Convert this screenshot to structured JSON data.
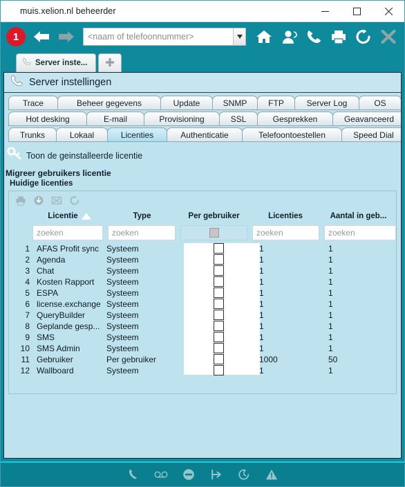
{
  "window": {
    "title": "muis.xelion.nl beheerder",
    "minimize_label": "Minimize",
    "maximize_label": "Maximize",
    "close_label": "Close"
  },
  "app_toolbar": {
    "badge": "1",
    "back_label": "Vorige",
    "forward_label": "Volgende",
    "search_placeholder": "<naam of telefoonnummer>",
    "search_value": "",
    "dropdown_label": "Open keuzelijst",
    "icons": [
      {
        "name": "home-icon",
        "label": "Home"
      },
      {
        "name": "contacts-icon",
        "label": "Contacten"
      },
      {
        "name": "phone-icon",
        "label": "Bellen"
      },
      {
        "name": "printer-icon",
        "label": "Afdrukken"
      },
      {
        "name": "refresh-icon",
        "label": "Vernieuwen"
      },
      {
        "name": "close-icon",
        "label": "Sluiten"
      }
    ]
  },
  "browser_tabs": {
    "tabs": [
      {
        "label": "Server inste...",
        "icon": "phone-icon",
        "active": true
      }
    ],
    "new_tab_label": "+"
  },
  "page": {
    "title": "Server instellingen",
    "icon": "phone-icon"
  },
  "nav_tabs": {
    "row1": [
      {
        "label": "Trace",
        "active": false
      },
      {
        "label": "Beheer gegevens",
        "active": false
      },
      {
        "label": "Update",
        "active": false
      },
      {
        "label": "SNMP",
        "active": false
      },
      {
        "label": "FTP",
        "active": false
      },
      {
        "label": "Server Log",
        "active": false
      },
      {
        "label": "OS",
        "active": false
      }
    ],
    "row2": [
      {
        "label": "Hot desking",
        "active": false
      },
      {
        "label": "E-mail",
        "active": false
      },
      {
        "label": "Provisioning",
        "active": false
      },
      {
        "label": "SSL",
        "active": false
      },
      {
        "label": "Gesprekken",
        "active": false
      },
      {
        "label": "Geavanceerd",
        "active": false
      }
    ],
    "row3": [
      {
        "label": "Trunks",
        "active": false
      },
      {
        "label": "Lokaal",
        "active": false
      },
      {
        "label": "Licenties",
        "active": true
      },
      {
        "label": "Authenticatie",
        "active": false
      },
      {
        "label": "Telefoontoestellen",
        "active": false
      },
      {
        "label": "Speed Dial",
        "active": false
      }
    ]
  },
  "content": {
    "show_license_link": "Toon de geinstalleerde licentie",
    "key_icon": "key-icon",
    "migrate_label": "Migreer gebruikers licentie",
    "current_licenses_label": "Huidige licenties"
  },
  "grid_toolbar": [
    {
      "name": "print-icon",
      "label": "Afdrukken"
    },
    {
      "name": "download-icon",
      "label": "Downloaden"
    },
    {
      "name": "export-icon",
      "label": "Exporteren"
    },
    {
      "name": "refresh-icon",
      "label": "Vernieuwen"
    }
  ],
  "table": {
    "columns": [
      {
        "key": "licentie",
        "label": "Licentie",
        "sort": "asc"
      },
      {
        "key": "type",
        "label": "Type",
        "sort": null
      },
      {
        "key": "per_gebruiker",
        "label": "Per gebruiker",
        "sort": null
      },
      {
        "key": "licenties",
        "label": "Licenties",
        "sort": null
      },
      {
        "key": "aantal_in_gebruik",
        "label": "Aantal in geb...",
        "sort": null
      }
    ],
    "filters": {
      "licentie_placeholder": "zoeken",
      "type_placeholder": "zoeken",
      "licenties_placeholder": "zoeken",
      "aantal_placeholder": "zoeken",
      "per_gebruiker_checkbox": false
    },
    "rows": [
      {
        "n": "1",
        "licentie": "AFAS Profit sync",
        "type": "Systeem",
        "per_gebruiker": false,
        "licenties": "1",
        "aantal_in_gebruik": "1"
      },
      {
        "n": "2",
        "licentie": "Agenda",
        "type": "Systeem",
        "per_gebruiker": false,
        "licenties": "1",
        "aantal_in_gebruik": "1"
      },
      {
        "n": "3",
        "licentie": "Chat",
        "type": "Systeem",
        "per_gebruiker": false,
        "licenties": "1",
        "aantal_in_gebruik": "1"
      },
      {
        "n": "4",
        "licentie": "Kosten Rapport",
        "type": "Systeem",
        "per_gebruiker": false,
        "licenties": "1",
        "aantal_in_gebruik": "1"
      },
      {
        "n": "5",
        "licentie": "ESPA",
        "type": "Systeem",
        "per_gebruiker": false,
        "licenties": "1",
        "aantal_in_gebruik": "1"
      },
      {
        "n": "6",
        "licentie": "license.exchange",
        "type": "Systeem",
        "per_gebruiker": false,
        "licenties": "1",
        "aantal_in_gebruik": "1"
      },
      {
        "n": "7",
        "licentie": "QueryBuilder",
        "type": "Systeem",
        "per_gebruiker": false,
        "licenties": "1",
        "aantal_in_gebruik": "1"
      },
      {
        "n": "8",
        "licentie": "Geplande gesp...",
        "type": "Systeem",
        "per_gebruiker": false,
        "licenties": "1",
        "aantal_in_gebruik": "1"
      },
      {
        "n": "9",
        "licentie": "SMS",
        "type": "Systeem",
        "per_gebruiker": false,
        "licenties": "1",
        "aantal_in_gebruik": "1"
      },
      {
        "n": "10",
        "licentie": "SMS Admin",
        "type": "Systeem",
        "per_gebruiker": false,
        "licenties": "1",
        "aantal_in_gebruik": "1"
      },
      {
        "n": "11",
        "licentie": "Gebruiker",
        "type": "Per gebruiker",
        "per_gebruiker": false,
        "licenties": "1000",
        "aantal_in_gebruik": "50"
      },
      {
        "n": "12",
        "licentie": "Wallboard",
        "type": "Systeem",
        "per_gebruiker": false,
        "licenties": "1",
        "aantal_in_gebruik": "1"
      }
    ]
  },
  "status_bar": [
    {
      "name": "phone-icon",
      "label": "Bellen"
    },
    {
      "name": "voicemail-icon",
      "label": "Voicemail"
    },
    {
      "name": "dnd-icon",
      "label": "Niet storen"
    },
    {
      "name": "forward-icon",
      "label": "Doorschakelen"
    },
    {
      "name": "history-icon",
      "label": "Geschiedenis"
    },
    {
      "name": "warning-icon",
      "label": "Waarschuwing"
    }
  ],
  "colors": {
    "teal": "#0e8a9c",
    "page_bg": "#bfe2ef",
    "badge_red": "#d91a2a",
    "status_bar": "#0a7f90",
    "accent_cyan": "#1fc7e0"
  }
}
